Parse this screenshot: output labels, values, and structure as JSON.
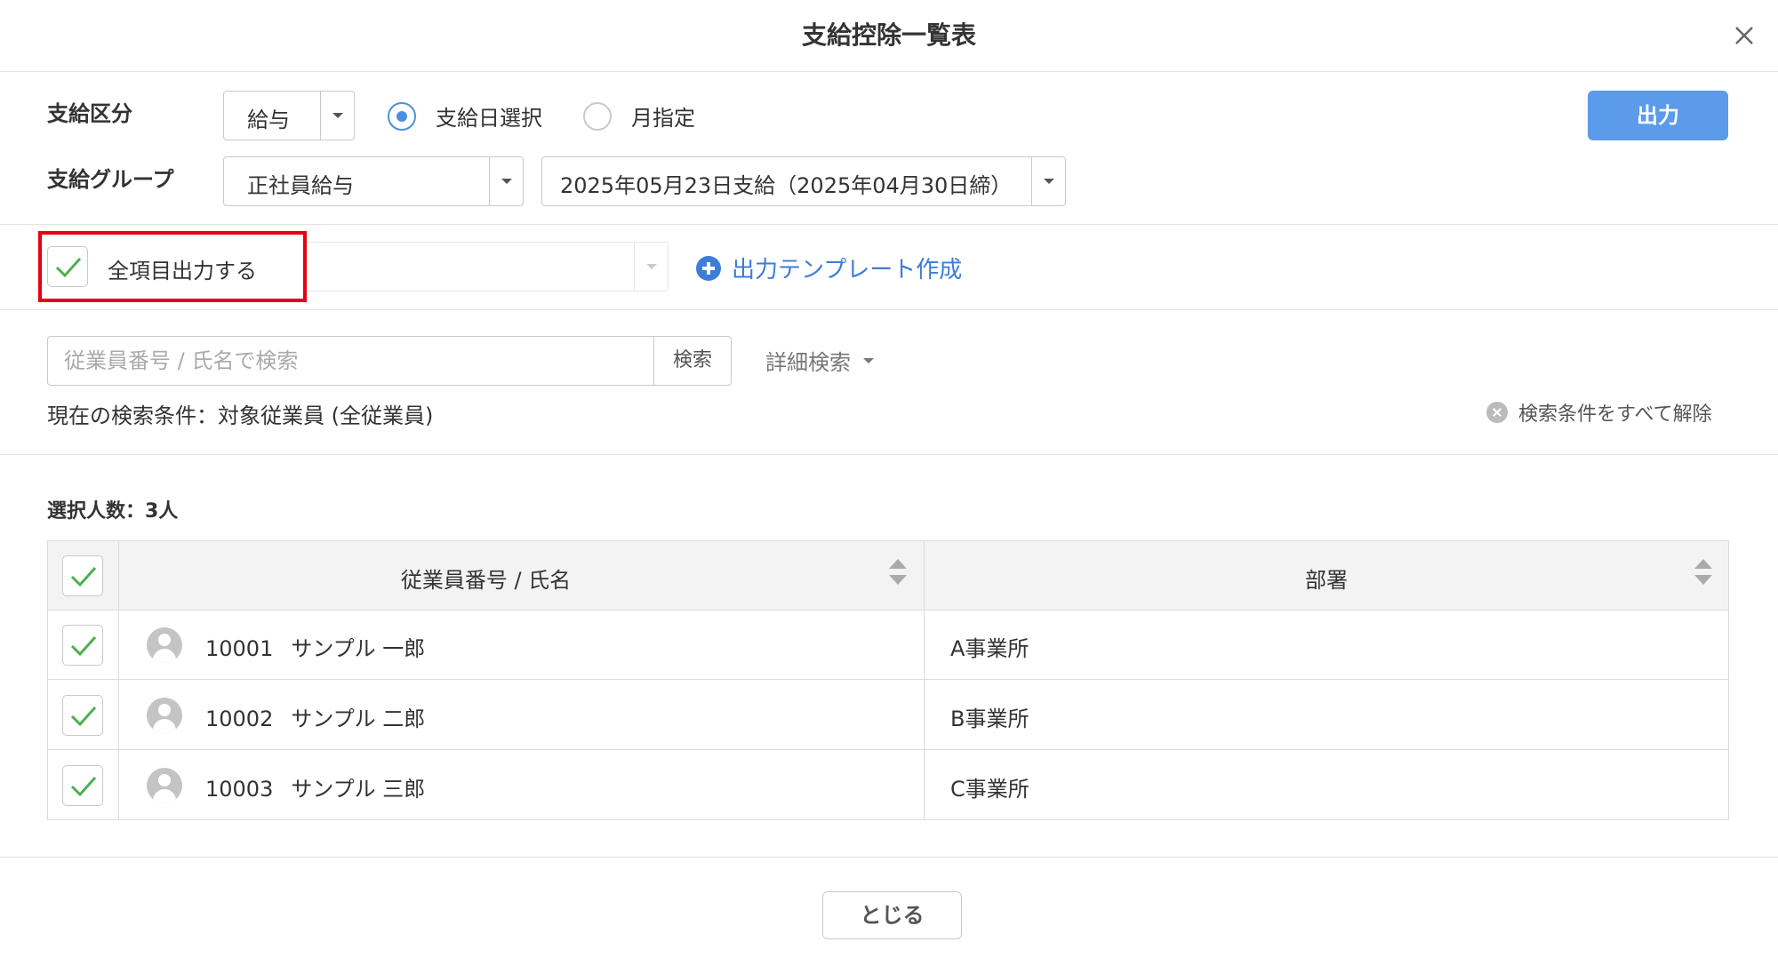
{
  "header": {
    "title": "支給控除一覧表"
  },
  "form": {
    "pay_type_label": "支給区分",
    "pay_type_value": "給与",
    "radio_pay_date": "支給日選択",
    "radio_month": "月指定",
    "group_label": "支給グループ",
    "group_value": "正社員給与",
    "date_value": "2025年05月23日支給（2025年04月30日締）",
    "output_button": "出力"
  },
  "template": {
    "all_items_label": "全項目出力する",
    "create_link": "出力テンプレート作成"
  },
  "search": {
    "placeholder": "従業員番号 / 氏名で検索",
    "button": "検索",
    "advanced": "詳細検索",
    "condition": "現在の検索条件：対象従業員 (全従業員)",
    "clear": "検索条件をすべて解除"
  },
  "selection": {
    "count_label": "選択人数：3人"
  },
  "table": {
    "columns": [
      "従業員番号 / 氏名",
      "部署"
    ],
    "rows": [
      {
        "number": "10001",
        "name": "サンプル 一郎",
        "dept": "A事業所"
      },
      {
        "number": "10002",
        "name": "サンプル 二郎",
        "dept": "B事業所"
      },
      {
        "number": "10003",
        "name": "サンプル 三郎",
        "dept": "C事業所"
      }
    ]
  },
  "footer": {
    "close_button": "とじる"
  },
  "colors": {
    "accent": "#5b9be9",
    "link": "#3b7dd8",
    "check": "#4caf50",
    "highlight": "#e60012"
  },
  "icons": [
    "close-icon",
    "dropdown-arrow-icon",
    "radio-icon",
    "check-icon",
    "plus-circle-icon",
    "sort-icon",
    "avatar-icon",
    "clear-icon"
  ]
}
